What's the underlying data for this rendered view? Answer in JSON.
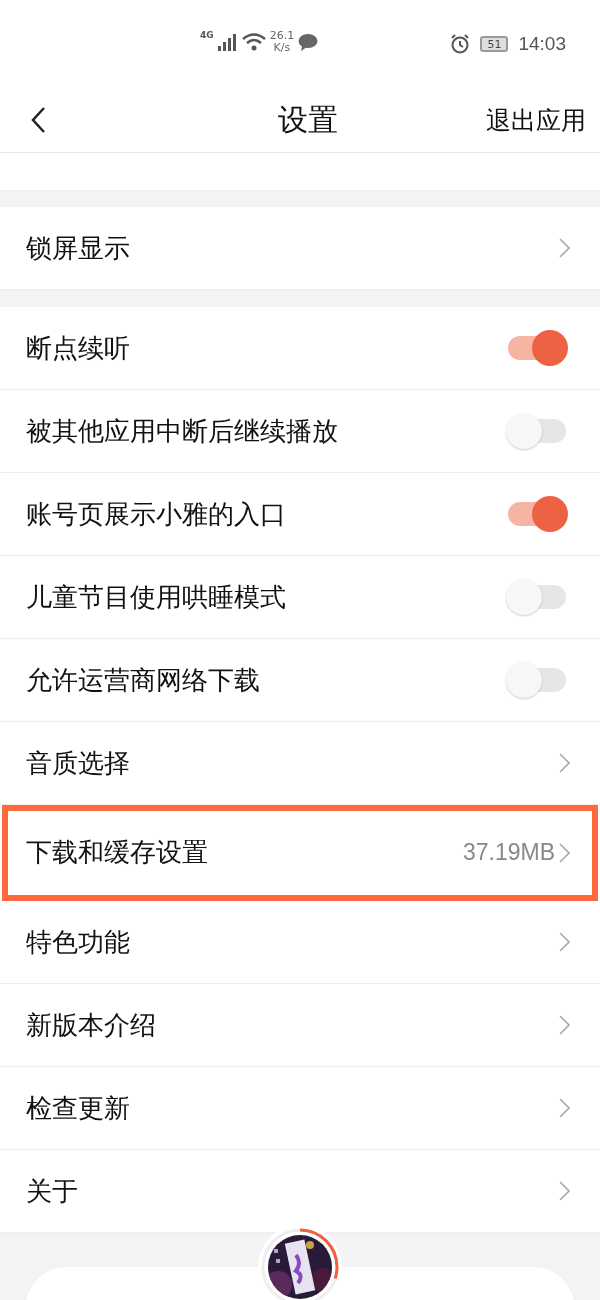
{
  "status_bar": {
    "network": "4G",
    "speed": "26.1",
    "speed_unit": "K/s",
    "battery": "51",
    "time": "14:03"
  },
  "header": {
    "title": "设置",
    "action": "退出应用"
  },
  "groups": [
    {
      "rows": [
        {
          "kind": "link",
          "label": "锁屏显示",
          "highlighted": false
        }
      ]
    },
    {
      "rows": [
        {
          "kind": "toggle",
          "label": "断点续听",
          "on": true
        },
        {
          "kind": "toggle",
          "label": "被其他应用中断后继续播放",
          "on": false
        },
        {
          "kind": "toggle",
          "label": "账号页展示小雅的入口",
          "on": true
        },
        {
          "kind": "toggle",
          "label": "儿童节目使用哄睡模式",
          "on": false
        },
        {
          "kind": "toggle",
          "label": "允许运营商网络下载",
          "on": false
        },
        {
          "kind": "link",
          "label": "音质选择",
          "highlighted": false
        },
        {
          "kind": "link",
          "label": "下载和缓存设置",
          "value": "37.19MB",
          "highlighted": true
        },
        {
          "kind": "link",
          "label": "特色功能",
          "highlighted": false
        },
        {
          "kind": "link",
          "label": "新版本介绍",
          "highlighted": false
        },
        {
          "kind": "link",
          "label": "检查更新",
          "highlighted": false
        },
        {
          "kind": "link",
          "label": "关于",
          "highlighted": false
        }
      ]
    }
  ],
  "mini_player": {
    "kind": "picture",
    "level": 0.3
  }
}
